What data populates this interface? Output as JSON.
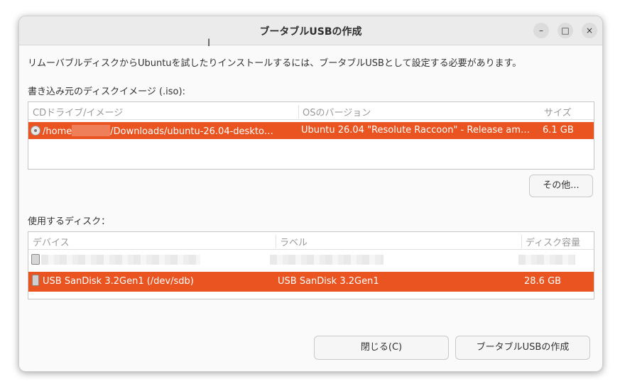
{
  "window": {
    "title": "ブータブルUSBの作成",
    "controls": {
      "minimize": "–",
      "maximize": "□",
      "close": "×"
    }
  },
  "description": "リムーバブルディスクからUbuntuを試したりインストールするには、ブータブルUSBとして設定する必要があります。",
  "iso_section": {
    "label": "書き込み元のディスクイメージ (.iso):",
    "columns": [
      "CDドライブ/イメージ",
      "OSのバージョン",
      "サイズ"
    ],
    "rows": [
      {
        "path_prefix": "/home",
        "path_suffix": "/Downloads/ubuntu-26.04-deskto…",
        "os_version": "Ubuntu 26.04 \"Resolute Raccoon\" - Release am…",
        "size": "6.1 GB",
        "selected": true
      }
    ],
    "other_button": "その他..."
  },
  "disk_section": {
    "label": "使用するディスク：",
    "columns": [
      "デバイス",
      "ラベル",
      "ディスク容量"
    ],
    "rows": [
      {
        "device": "",
        "label": "",
        "size": "",
        "selected": false
      },
      {
        "device": "USB SanDisk 3.2Gen1 (/dev/sdb)",
        "label": "USB SanDisk 3.2Gen1",
        "size": "28.6 GB",
        "selected": true
      }
    ]
  },
  "buttons": {
    "close": "閉じる(C)",
    "create": "ブータブルUSBの作成"
  },
  "colors": {
    "selection": "#e95420"
  }
}
